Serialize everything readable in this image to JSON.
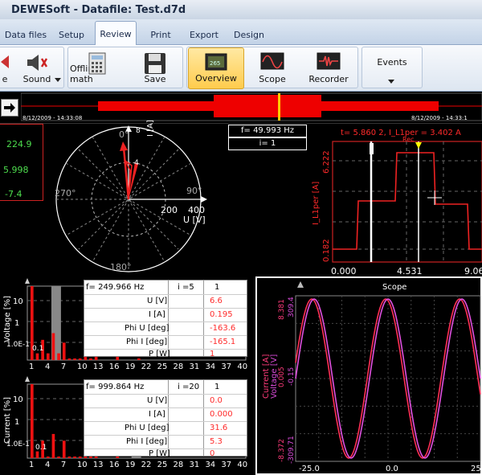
{
  "window": {
    "title": "DEWESoft - Datafile: Test.d7d"
  },
  "menu": {
    "tabs": [
      "Data files",
      "Setup",
      "Review",
      "Print",
      "Export",
      "Design"
    ],
    "active": "Review"
  },
  "ribbon": {
    "buttons": [
      {
        "label": "e"
      },
      {
        "label": "Sound"
      },
      {
        "label": "Offline math"
      },
      {
        "label": "Save"
      },
      {
        "label": "Overview"
      },
      {
        "label": "Scope"
      },
      {
        "label": "Recorder"
      },
      {
        "label": "Events"
      }
    ],
    "active": "Overview"
  },
  "overview": {
    "start_time": "8/12/2009 - 14:33:08",
    "end_time": "8/12/2009 - 14:33:1"
  },
  "left_readout": {
    "values": [
      "224.9",
      "5.998",
      "-7.4"
    ]
  },
  "phasor": {
    "frequency": "f= 49.993 Hz",
    "index": "i= 1",
    "angle_labels": [
      "0°",
      "90°",
      "180°",
      "270°"
    ],
    "axis_i_label": "I [A]",
    "axis_u_label": "U [V]",
    "ticks": [
      "200",
      "400"
    ],
    "i_ticks": [
      "4",
      "8"
    ]
  },
  "recorder": {
    "cursor_text": "t= 5.860 2, I_L1per = 3.402 A",
    "y_label": "I_L1per [A]",
    "y_ticks": [
      "6.222",
      "0.182"
    ],
    "x_ticks": [
      "0.000",
      "4.531",
      "9.06"
    ],
    "marker": "Rec"
  },
  "harmonics_voltage": {
    "ylabel": "Voltage [%]",
    "y_ticks": [
      "10",
      "1",
      "1.0E-1",
      "0.1"
    ],
    "x_ticks": [
      "1",
      "4",
      "7",
      "10",
      "13",
      "16",
      "19",
      "22",
      "25",
      "28",
      "31",
      "34",
      "37",
      "40"
    ],
    "frequency": "f= 249.966 Hz",
    "index": "i =5",
    "col_header": "1",
    "rows": [
      {
        "label": "U [V]",
        "value": "6.6"
      },
      {
        "label": "I [A]",
        "value": "0.195"
      },
      {
        "label": "Phi U [deg]",
        "value": "-163.6"
      },
      {
        "label": "Phi I [deg]",
        "value": "-165.1"
      },
      {
        "label": "P [W]",
        "value": "1"
      }
    ]
  },
  "harmonics_current": {
    "ylabel": "Current [%]",
    "y_ticks": [
      "10",
      "1",
      "1.0E-1",
      "0.1"
    ],
    "x_ticks": [
      "1",
      "4",
      "7",
      "10",
      "13",
      "16",
      "19",
      "22",
      "25",
      "28",
      "31",
      "34",
      "37",
      "40"
    ],
    "frequency": "f= 999.864 Hz",
    "index": "i =20",
    "col_header": "1",
    "rows": [
      {
        "label": "U [V]",
        "value": "0.0"
      },
      {
        "label": "I [A]",
        "value": "0.000"
      },
      {
        "label": "Phi U [deg]",
        "value": "31.6"
      },
      {
        "label": "Phi I [deg]",
        "value": "5.3"
      },
      {
        "label": "P [W]",
        "value": "0"
      }
    ]
  },
  "scope": {
    "title": "Scope",
    "current_label": "Current [A]",
    "voltage_label": "Voltage [V]",
    "current_ticks": [
      "8.381",
      "0.005",
      "-8.372"
    ],
    "voltage_ticks": [
      "309.4",
      "-0.15",
      "-309.71"
    ],
    "x_ticks": [
      "-25.0",
      "0.0",
      "25"
    ]
  },
  "chart_data": [
    {
      "type": "bar",
      "title": "",
      "ylabel": "Voltage [%]",
      "categories": [
        1,
        2,
        3,
        4,
        5,
        6,
        7,
        8,
        9,
        10,
        11,
        12,
        13,
        14,
        15,
        16,
        17,
        18,
        19,
        20,
        21,
        22,
        23,
        24,
        25,
        26,
        27,
        28,
        29,
        30,
        31,
        32,
        33,
        34,
        35,
        36,
        37,
        38,
        39,
        40
      ],
      "values": [
        100,
        0.1,
        0.4,
        0.1,
        0.8,
        0.1,
        0.3,
        0.05,
        0.05,
        0.05,
        0.15,
        0.05,
        0.1,
        0,
        0,
        0,
        0.08,
        0,
        0,
        0,
        0.05,
        0,
        0,
        0,
        0,
        0,
        0,
        0,
        0,
        0,
        0,
        0,
        0,
        0,
        0,
        0,
        0,
        0,
        0,
        0
      ],
      "highlight": 5
    },
    {
      "type": "bar",
      "title": "",
      "ylabel": "Current [%]",
      "categories": [
        1,
        2,
        3,
        4,
        5,
        6,
        7,
        8,
        9,
        10,
        11,
        12,
        13,
        14,
        15,
        16,
        17,
        18,
        19,
        20,
        21,
        22,
        23,
        24,
        25,
        26,
        27,
        28,
        29,
        30,
        31,
        32,
        33,
        34,
        35,
        36,
        37,
        38,
        39,
        40
      ],
      "values": [
        100,
        0.1,
        0.3,
        0.05,
        0.6,
        0.05,
        0.3,
        0.05,
        0.05,
        0.05,
        0.15,
        0.05,
        0.1,
        0,
        0,
        0,
        0.05,
        0,
        0,
        0,
        0,
        0,
        0,
        0,
        0,
        0,
        0,
        0,
        0,
        0,
        0,
        0,
        0,
        0,
        0,
        0,
        0,
        0,
        0,
        0
      ],
      "highlight": 20
    },
    {
      "type": "line",
      "title": "Scope",
      "xlabel": "",
      "x_range": [
        -25.0,
        25
      ],
      "series": [
        {
          "name": "Current [A]",
          "amplitude": 8.381,
          "period": 20
        },
        {
          "name": "Voltage [V]",
          "amplitude": 309.4,
          "period": 20
        }
      ]
    }
  ]
}
